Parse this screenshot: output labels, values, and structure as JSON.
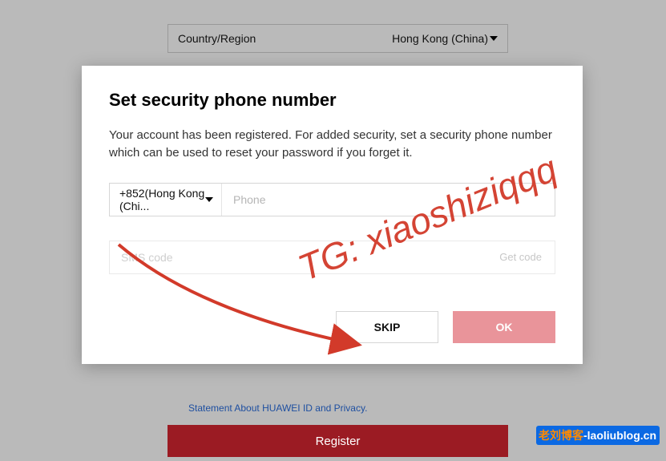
{
  "background": {
    "country_label": "Country/Region",
    "country_value": "Hong Kong (China)",
    "statement": "Statement About HUAWEI ID and Privacy.",
    "register": "Register"
  },
  "modal": {
    "title": "Set security phone number",
    "description": "Your account has been registered. For added security, set a security phone number which can be used to reset your password if you forget it.",
    "dial_code": "+852(Hong Kong (Chi...",
    "phone_placeholder": "Phone",
    "sms_placeholder": "SMS code",
    "get_code": "Get code",
    "skip": "SKIP",
    "ok": "OK"
  },
  "overlay": {
    "watermark": "TG: xiaoshiziqqq",
    "blog_left": "老刘博客",
    "blog_right": "-laoliublog.cn"
  }
}
